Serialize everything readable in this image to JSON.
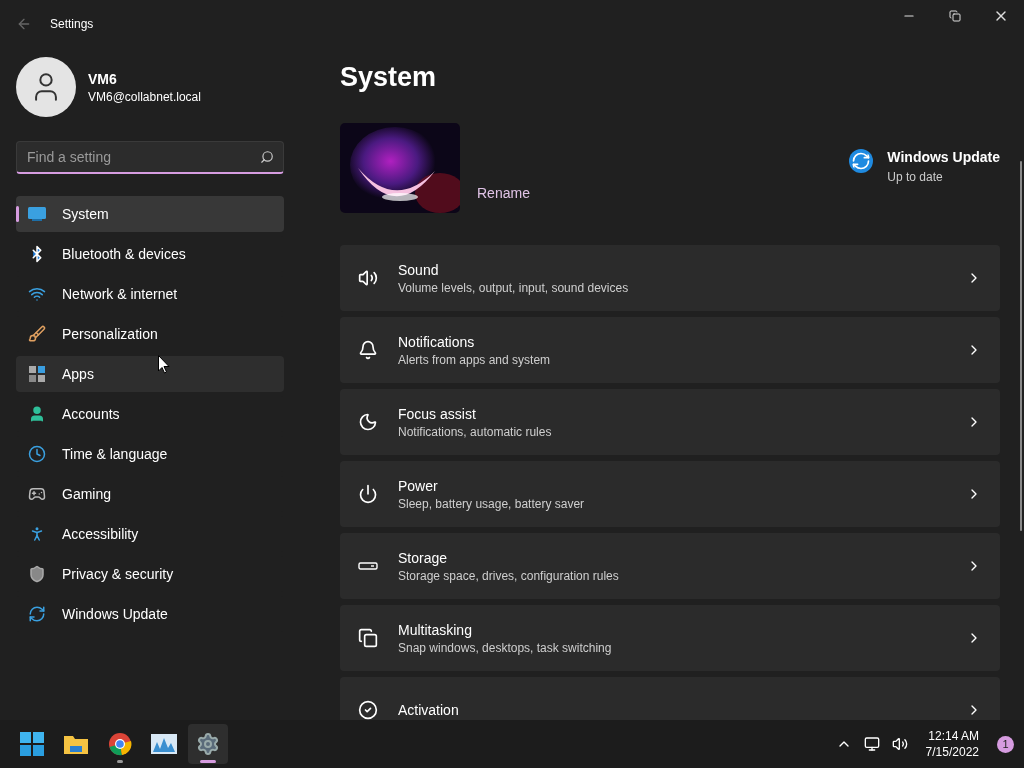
{
  "window": {
    "title": "Settings"
  },
  "profile": {
    "name": "VM6",
    "email": "VM6@collabnet.local"
  },
  "search": {
    "placeholder": "Find a setting"
  },
  "nav": [
    {
      "label": "System",
      "selected": true,
      "hovered": false
    },
    {
      "label": "Bluetooth & devices",
      "selected": false,
      "hovered": false
    },
    {
      "label": "Network & internet",
      "selected": false,
      "hovered": false
    },
    {
      "label": "Personalization",
      "selected": false,
      "hovered": false
    },
    {
      "label": "Apps",
      "selected": false,
      "hovered": true
    },
    {
      "label": "Accounts",
      "selected": false,
      "hovered": false
    },
    {
      "label": "Time & language",
      "selected": false,
      "hovered": false
    },
    {
      "label": "Gaming",
      "selected": false,
      "hovered": false
    },
    {
      "label": "Accessibility",
      "selected": false,
      "hovered": false
    },
    {
      "label": "Privacy & security",
      "selected": false,
      "hovered": false
    },
    {
      "label": "Windows Update",
      "selected": false,
      "hovered": false
    }
  ],
  "page": {
    "title": "System",
    "rename": "Rename",
    "update": {
      "title": "Windows Update",
      "status": "Up to date"
    }
  },
  "cards": [
    {
      "title": "Sound",
      "subtitle": "Volume levels, output, input, sound devices"
    },
    {
      "title": "Notifications",
      "subtitle": "Alerts from apps and system"
    },
    {
      "title": "Focus assist",
      "subtitle": "Notifications, automatic rules"
    },
    {
      "title": "Power",
      "subtitle": "Sleep, battery usage, battery saver"
    },
    {
      "title": "Storage",
      "subtitle": "Storage space, drives, configuration rules"
    },
    {
      "title": "Multitasking",
      "subtitle": "Snap windows, desktops, task switching"
    },
    {
      "title": "Activation"
    }
  ],
  "taskbar": {
    "apps": [
      {
        "selected": false,
        "running": false
      },
      {
        "selected": false,
        "running": false
      },
      {
        "selected": false,
        "running": true
      },
      {
        "selected": false,
        "running": false
      },
      {
        "selected": true,
        "running": true
      }
    ],
    "time": "12:14 AM",
    "date": "7/15/2022",
    "notifications": "1"
  }
}
